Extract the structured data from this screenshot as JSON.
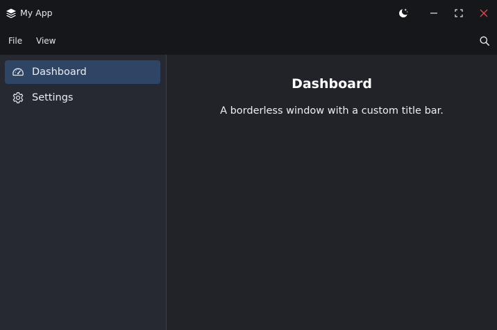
{
  "app": {
    "title": "My App",
    "icon": "stack-layers-icon"
  },
  "titlebar": {
    "theme_icon": "moon-stars-icon",
    "minimize_icon": "minimize-icon",
    "maximize_icon": "maximize-icon",
    "close_icon": "close-icon",
    "close_color": "#e0494f"
  },
  "menubar": {
    "items": [
      {
        "label": "File"
      },
      {
        "label": "View"
      }
    ],
    "search_icon": "search-icon"
  },
  "sidebar": {
    "items": [
      {
        "label": "Dashboard",
        "icon": "gauge-icon",
        "active": true
      },
      {
        "label": "Settings",
        "icon": "gear-icon",
        "active": false
      }
    ],
    "active_color": "#2f4566"
  },
  "main": {
    "title": "Dashboard",
    "description": "A borderless window with a custom title bar."
  }
}
